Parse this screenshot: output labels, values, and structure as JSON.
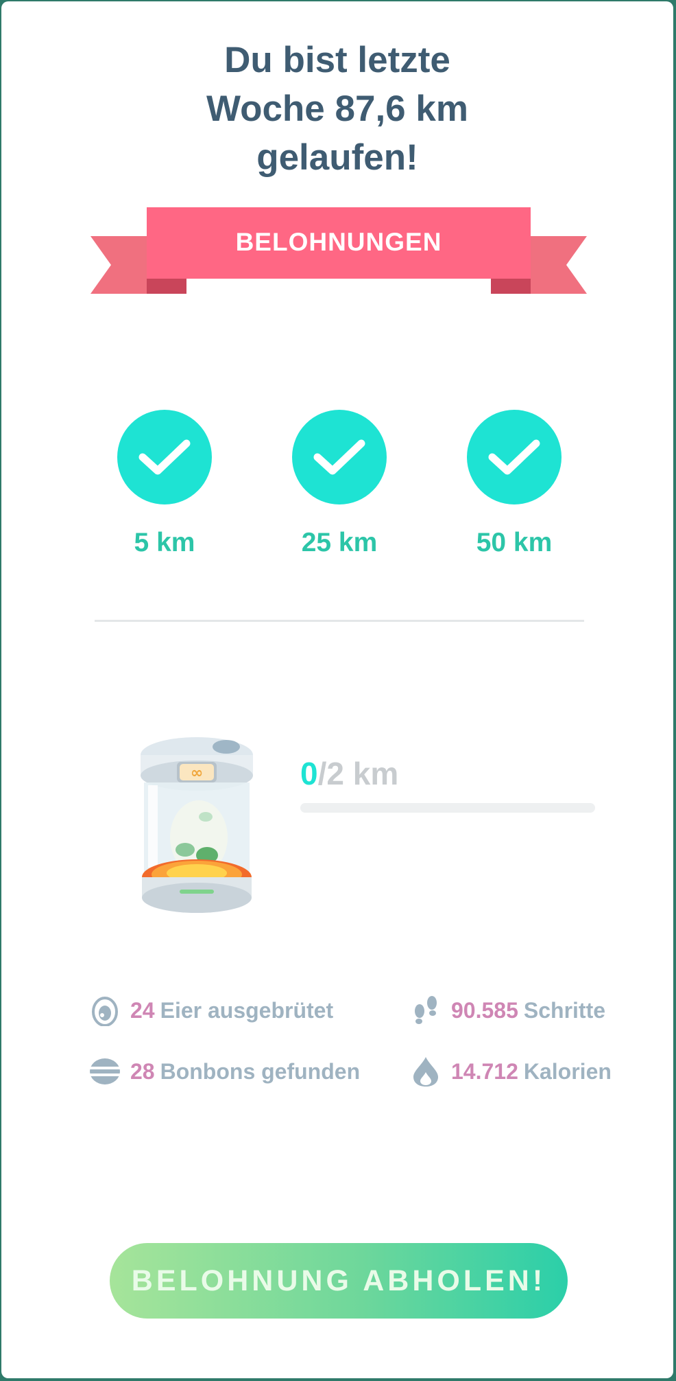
{
  "title": {
    "line1": "Du bist letzte",
    "line2": "Woche 87,6 km",
    "line3": "gelaufen!"
  },
  "banner": {
    "label": "BELOHNUNGEN",
    "color": "#ff6784"
  },
  "milestones": [
    {
      "label": "5 km",
      "reached": true
    },
    {
      "label": "25 km",
      "reached": true
    },
    {
      "label": "50 km",
      "reached": true
    }
  ],
  "incubator": {
    "current": "0",
    "total": "/2 km",
    "progress_fraction": 0
  },
  "stats": [
    {
      "icon": "egg-icon",
      "value": "24",
      "label": "Eier ausgebrütet"
    },
    {
      "icon": "footsteps-icon",
      "value": "90.585",
      "label": "Schritte"
    },
    {
      "icon": "candy-icon",
      "value": "28",
      "label": "Bonbons gefunden"
    },
    {
      "icon": "flame-icon",
      "value": "14.712",
      "label": "Kalorien"
    }
  ],
  "claim_button": {
    "label": "BELOHNUNG ABHOLEN!"
  },
  "colors": {
    "accent": "#1ee3d3",
    "milestone_text": "#2cc5a8",
    "title_text": "#3f5c72",
    "stat_value": "#cf86b4",
    "stat_label": "#9fb3c1"
  }
}
